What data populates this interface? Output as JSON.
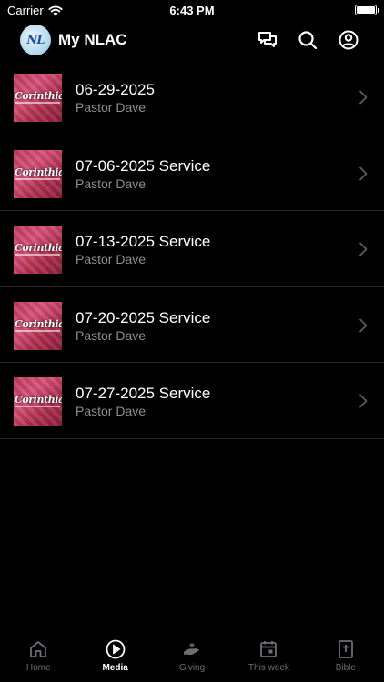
{
  "status_bar": {
    "carrier": "Carrier",
    "time": "6:43 PM"
  },
  "header": {
    "logo_text": "NL",
    "title": "My NLAC",
    "icons": [
      "chat-icon",
      "search-icon",
      "account-icon"
    ]
  },
  "media_items": [
    {
      "title": "06-29-2025",
      "subtitle": "Pastor Dave",
      "thumb_text": "Corinthians"
    },
    {
      "title": "07-06-2025 Service",
      "subtitle": "Pastor Dave",
      "thumb_text": "Corinthians"
    },
    {
      "title": "07-13-2025 Service",
      "subtitle": "Pastor Dave",
      "thumb_text": "Corinthians"
    },
    {
      "title": "07-20-2025 Service",
      "subtitle": "Pastor Dave",
      "thumb_text": "Corinthians"
    },
    {
      "title": "07-27-2025 Service",
      "subtitle": "Pastor Dave",
      "thumb_text": "Corinthians"
    }
  ],
  "tabs": [
    {
      "label": "Home",
      "icon": "home-icon",
      "active": false
    },
    {
      "label": "Media",
      "icon": "play-icon",
      "active": true
    },
    {
      "label": "Giving",
      "icon": "giving-icon",
      "active": false
    },
    {
      "label": "This week",
      "icon": "calendar-icon",
      "active": false
    },
    {
      "label": "Bible",
      "icon": "bible-icon",
      "active": false
    }
  ],
  "colors": {
    "background": "#000000",
    "secondary_text": "#8e8e93",
    "inactive_tab": "#6e6e73",
    "separator": "#2a2a2a",
    "thumb_accent": "#c33b5e"
  }
}
